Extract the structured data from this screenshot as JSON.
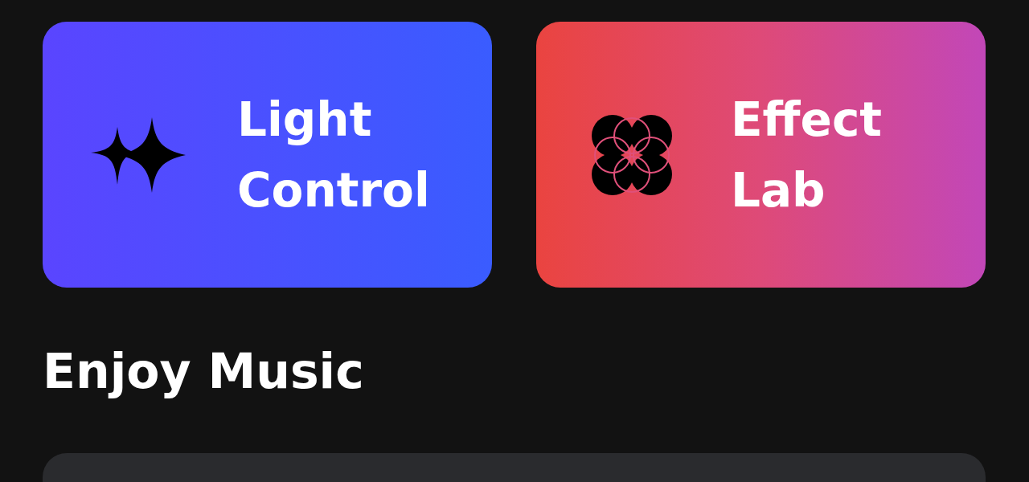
{
  "cards": [
    {
      "title": "Light Control",
      "kind": "light"
    },
    {
      "title": "Effect Lab",
      "kind": "effect"
    }
  ],
  "section": {
    "title": "Enjoy Music"
  }
}
